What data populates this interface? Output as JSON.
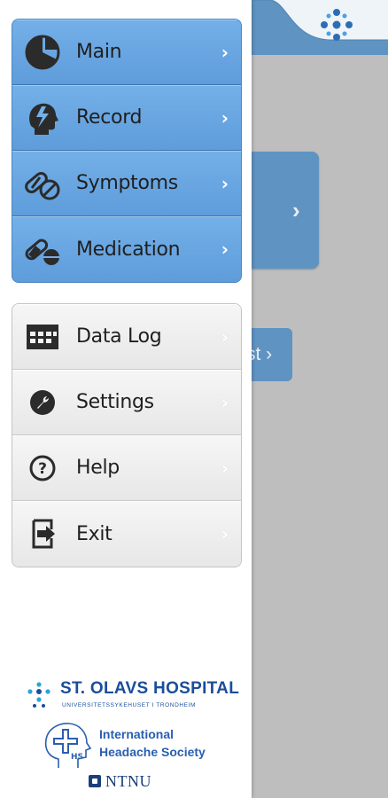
{
  "menu": {
    "primary_items": [
      {
        "label": "Main",
        "icon": "pie-chart-icon"
      },
      {
        "label": "Record",
        "icon": "head-lightning-icon"
      },
      {
        "label": "Symptoms",
        "icon": "pills-capsule-icon"
      },
      {
        "label": "Medication",
        "icon": "medication-pill-icon"
      }
    ],
    "secondary_items": [
      {
        "label": "Data Log",
        "icon": "table-grid-icon"
      },
      {
        "label": "Settings",
        "icon": "wrench-icon"
      },
      {
        "label": "Help",
        "icon": "question-circle-icon"
      },
      {
        "label": "Exit",
        "icon": "exit-door-icon"
      }
    ],
    "chevron": "›"
  },
  "background": {
    "button_fragment": "st",
    "card_chevron": "›"
  },
  "footer": {
    "hospital_name": "ST. OLAVS HOSPITAL",
    "hospital_sub": "UNIVERSITETSSYKEHUSET I TRONDHEIM",
    "ihs_line1": "International",
    "ihs_line2": "Headache Society",
    "ntnu": "NTNU"
  },
  "colors": {
    "primary_blue": "#5e9cdb",
    "secondary_gray": "#ececec",
    "brand_navy": "#1b4d9b"
  }
}
